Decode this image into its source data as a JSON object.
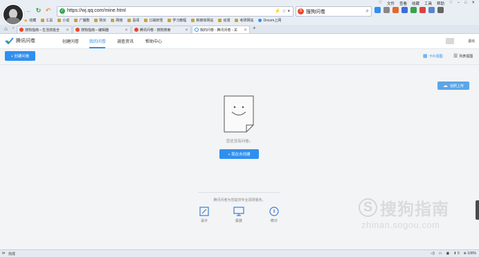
{
  "browser": {
    "url": "https://wj.qq.com/mine.html",
    "search_text": "搜狗问卷",
    "menu": [
      "文件",
      "查看",
      "收藏",
      "工具",
      "帮助"
    ],
    "bookmarks": [
      "收藏",
      "工具",
      "小说",
      "广播剧",
      "购买",
      "网络",
      "喜闻",
      "口袋妖怪",
      "学习教程",
      "新媒体网站",
      "动漫",
      "考研网站",
      "Dncom上网"
    ],
    "tabs": [
      {
        "label": "搜狗指南－生活技能全"
      },
      {
        "label": "搜狗指南－编辑器"
      },
      {
        "label": "腾讯问卷 - 搜狗搜索"
      },
      {
        "label": "我的问卷 - 腾讯问卷 - 关"
      }
    ],
    "new_tab": "+"
  },
  "site": {
    "logo_text": "腾讯问卷",
    "nav": [
      "创建问卷",
      "我的问卷",
      "调查资讯",
      "帮助中心"
    ],
    "logout": "退出"
  },
  "toolbar": {
    "create_label": "+ 创建问卷",
    "card_view": "卡片视图",
    "list_view": "列表视图",
    "upload_label": "拍照上传"
  },
  "empty": {
    "text": "您还没有问卷。",
    "button": "+ 现在去创建"
  },
  "footer": {
    "desc": "腾讯问卷为您提供专业调研服务。",
    "features": [
      {
        "label": "设计",
        "icon": "edit-icon"
      },
      {
        "label": "投放",
        "icon": "monitor-icon"
      },
      {
        "label": "统计",
        "icon": "info-icon"
      }
    ]
  },
  "watermark": {
    "text": "搜狗指南",
    "url": "zhinan.sogou.com"
  },
  "status": {
    "left": "完成",
    "zoom": "100%",
    "download": "0"
  }
}
